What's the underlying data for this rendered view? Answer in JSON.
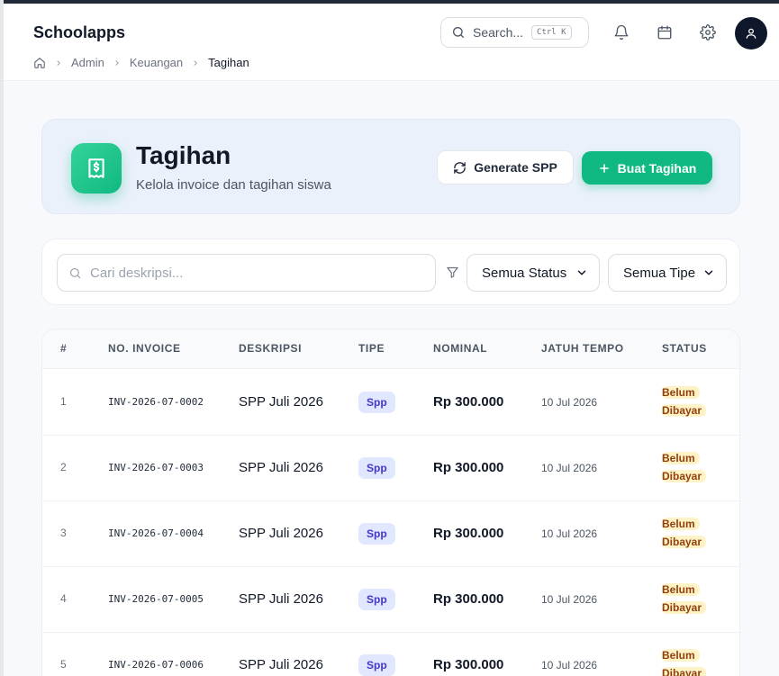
{
  "app": {
    "title": "Schoolapps"
  },
  "breadcrumb": {
    "items": [
      "Admin",
      "Keuangan",
      "Tagihan"
    ]
  },
  "search": {
    "label": "Search...",
    "shortcut": "Ctrl K"
  },
  "header_icons": [
    "bell-icon",
    "calendar-icon",
    "gear-icon",
    "user-icon"
  ],
  "page": {
    "title": "Tagihan",
    "subtitle": "Kelola invoice dan tagihan siswa",
    "icon": "invoice-icon",
    "generate_label": "Generate SPP",
    "create_label": "Buat Tagihan"
  },
  "filters": {
    "search_placeholder": "Cari deskripsi...",
    "status": "Semua Status",
    "tipe": "Semua Tipe"
  },
  "table": {
    "columns": [
      "#",
      "NO. INVOICE",
      "DESKRIPSI",
      "TIPE",
      "NOMINAL",
      "JATUH TEMPO",
      "STATUS"
    ],
    "rows": [
      {
        "num": "1",
        "invoice": "INV-2026-07-0002",
        "desc": "SPP Juli 2026",
        "tipe": "Spp",
        "nominal": "Rp 300.000",
        "due": "10 Jul 2026",
        "status": "Belum Dibayar"
      },
      {
        "num": "2",
        "invoice": "INV-2026-07-0003",
        "desc": "SPP Juli 2026",
        "tipe": "Spp",
        "nominal": "Rp 300.000",
        "due": "10 Jul 2026",
        "status": "Belum Dibayar"
      },
      {
        "num": "3",
        "invoice": "INV-2026-07-0004",
        "desc": "SPP Juli 2026",
        "tipe": "Spp",
        "nominal": "Rp 300.000",
        "due": "10 Jul 2026",
        "status": "Belum Dibayar"
      },
      {
        "num": "4",
        "invoice": "INV-2026-07-0005",
        "desc": "SPP Juli 2026",
        "tipe": "Spp",
        "nominal": "Rp 300.000",
        "due": "10 Jul 2026",
        "status": "Belum Dibayar"
      },
      {
        "num": "5",
        "invoice": "INV-2026-07-0006",
        "desc": "SPP Juli 2026",
        "tipe": "Spp",
        "nominal": "Rp 300.000",
        "due": "10 Jul 2026",
        "status": "Belum Dibayar"
      }
    ]
  },
  "colors": {
    "accent": "#10b981",
    "status_unpaid_bg": "#fef3c7",
    "status_unpaid_text": "#92400e",
    "tipe_bg": "#e0e7ff",
    "tipe_text": "#4338ca"
  }
}
